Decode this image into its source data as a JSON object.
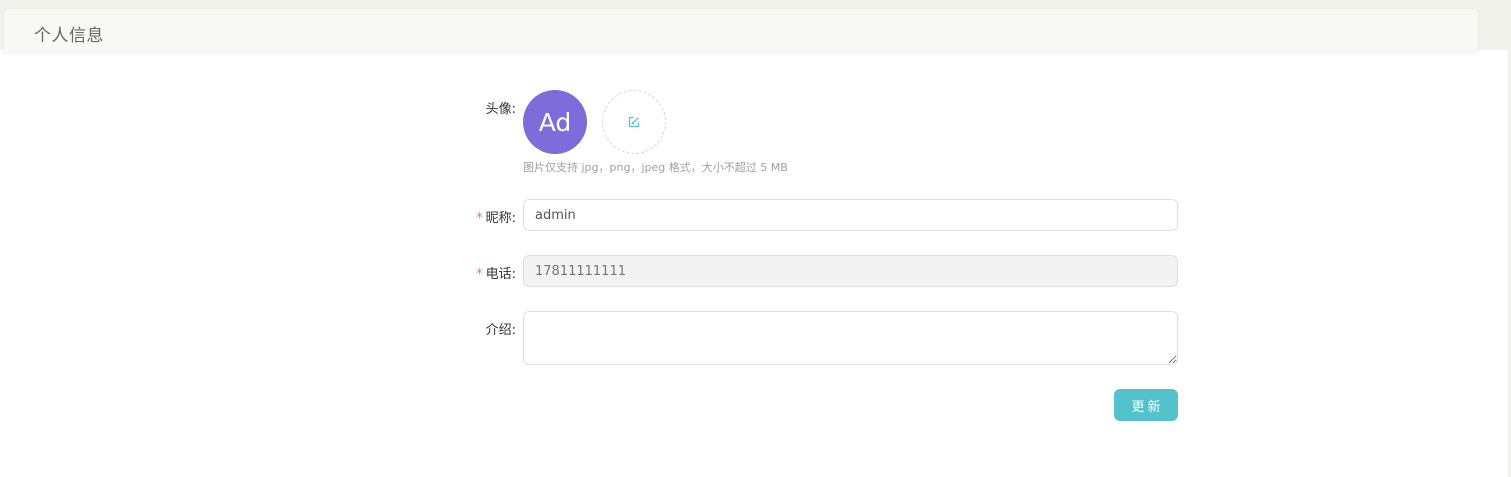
{
  "header": {
    "title": "个人信息"
  },
  "form": {
    "avatar": {
      "label": "头像:",
      "initials": "Ad",
      "color": "#7d6cd9",
      "upload_icon": "edit-icon",
      "hint": "图片仅支持 jpg，png，jpeg 格式，大小不超过 5 MB"
    },
    "nickname": {
      "required_mark": "*",
      "label": "昵称:",
      "value": "admin"
    },
    "phone": {
      "required_mark": "*",
      "label": "电话:",
      "placeholder": "17811111111",
      "disabled": true
    },
    "intro": {
      "label": "介绍:",
      "value": ""
    },
    "submit_label": "更新",
    "accent_color": "#53c2cb",
    "required_color": "#f56c6c"
  }
}
